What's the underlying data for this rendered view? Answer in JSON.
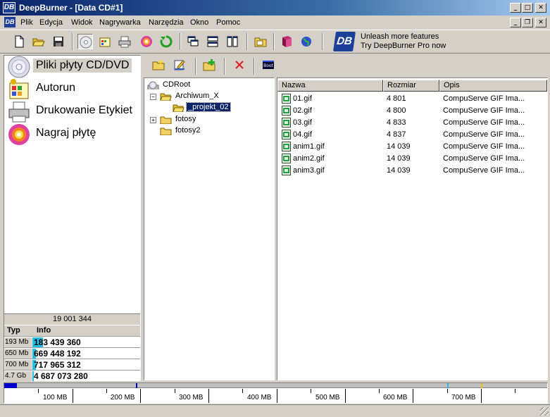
{
  "window": {
    "title": "DeepBurner - [Data CD#1]",
    "app_icon": "DB"
  },
  "menu": [
    "Plik",
    "Edycja",
    "Widok",
    "Nagrywarka",
    "Narzędzia",
    "Okno",
    "Pomoc"
  ],
  "toolbar": {
    "buttons": [
      "new-icon",
      "open-icon",
      "save-icon",
      "data-cd-icon",
      "autorun-icon",
      "print-icon",
      "burn-icon",
      "refresh-icon",
      "cascade-icon",
      "tile-horizontal-icon",
      "tile-vertical-icon",
      "folder-icon",
      "book-icon",
      "globe-icon"
    ]
  },
  "promo": {
    "logo": "DB",
    "line1": "Unleash more features",
    "line2": "Try DeepBurner Pro now"
  },
  "nav": [
    {
      "label": "Pliki płyty CD/DVD",
      "icon": "cd-icon",
      "selected": true
    },
    {
      "label": "Autorun",
      "icon": "autorun-icon",
      "selected": false
    },
    {
      "label": "Drukowanie Etykiet",
      "icon": "printer-icon",
      "selected": false
    },
    {
      "label": "Nagraj płytę",
      "icon": "burn-disc-icon",
      "selected": false
    }
  ],
  "capacity": {
    "total": "19 001 344",
    "header_type": "Typ",
    "header_info": "Info",
    "rows": [
      {
        "type": "193 Mb",
        "value": "183 439 360",
        "fill": 0.1
      },
      {
        "type": "650 Mb",
        "value": "669 448 192",
        "fill": 0.03
      },
      {
        "type": "700 Mb",
        "value": "717 965 312",
        "fill": 0.03
      },
      {
        "type": "4.7 Gb",
        "value": "4 687 073 280",
        "fill": 0.005
      }
    ]
  },
  "file_toolbar": [
    "new-folder-icon",
    "rename-icon",
    "add-files-icon",
    "delete-icon",
    "boot-icon"
  ],
  "file_toolbar_boot_label": "Boot",
  "tree": {
    "root": "CDRoot",
    "items": [
      {
        "label": "Archiwum_X",
        "expanded": true
      },
      {
        "label": "_projekt_02",
        "selected": true
      },
      {
        "label": "fotosy",
        "expandable": true
      },
      {
        "label": "fotosy2"
      }
    ]
  },
  "list": {
    "columns": [
      "Nazwa",
      "Rozmiar",
      "Opis"
    ],
    "rows": [
      {
        "name": "01.gif",
        "size": "4 801",
        "desc": "CompuServe GIF Ima..."
      },
      {
        "name": "02.gif",
        "size": "4 800",
        "desc": "CompuServe GIF Ima..."
      },
      {
        "name": "03.gif",
        "size": "4 833",
        "desc": "CompuServe GIF Ima..."
      },
      {
        "name": "04.gif",
        "size": "4 837",
        "desc": "CompuServe GIF Ima..."
      },
      {
        "name": "anim1.gif",
        "size": "14 039",
        "desc": "CompuServe GIF Ima..."
      },
      {
        "name": "anim2.gif",
        "size": "14 039",
        "desc": "CompuServe GIF Ima..."
      },
      {
        "name": "anim3.gif",
        "size": "14 039",
        "desc": "CompuServe GIF Ima..."
      }
    ]
  },
  "ruler": {
    "labels": [
      "100 MB",
      "200 MB",
      "300 MB",
      "400 MB",
      "500 MB",
      "600 MB",
      "700 MB"
    ],
    "used_mb": 19,
    "markers_mb": [
      193,
      650,
      700
    ],
    "marker_colors": [
      "#0000cc",
      "#22c0e8",
      "#e8c000"
    ]
  }
}
